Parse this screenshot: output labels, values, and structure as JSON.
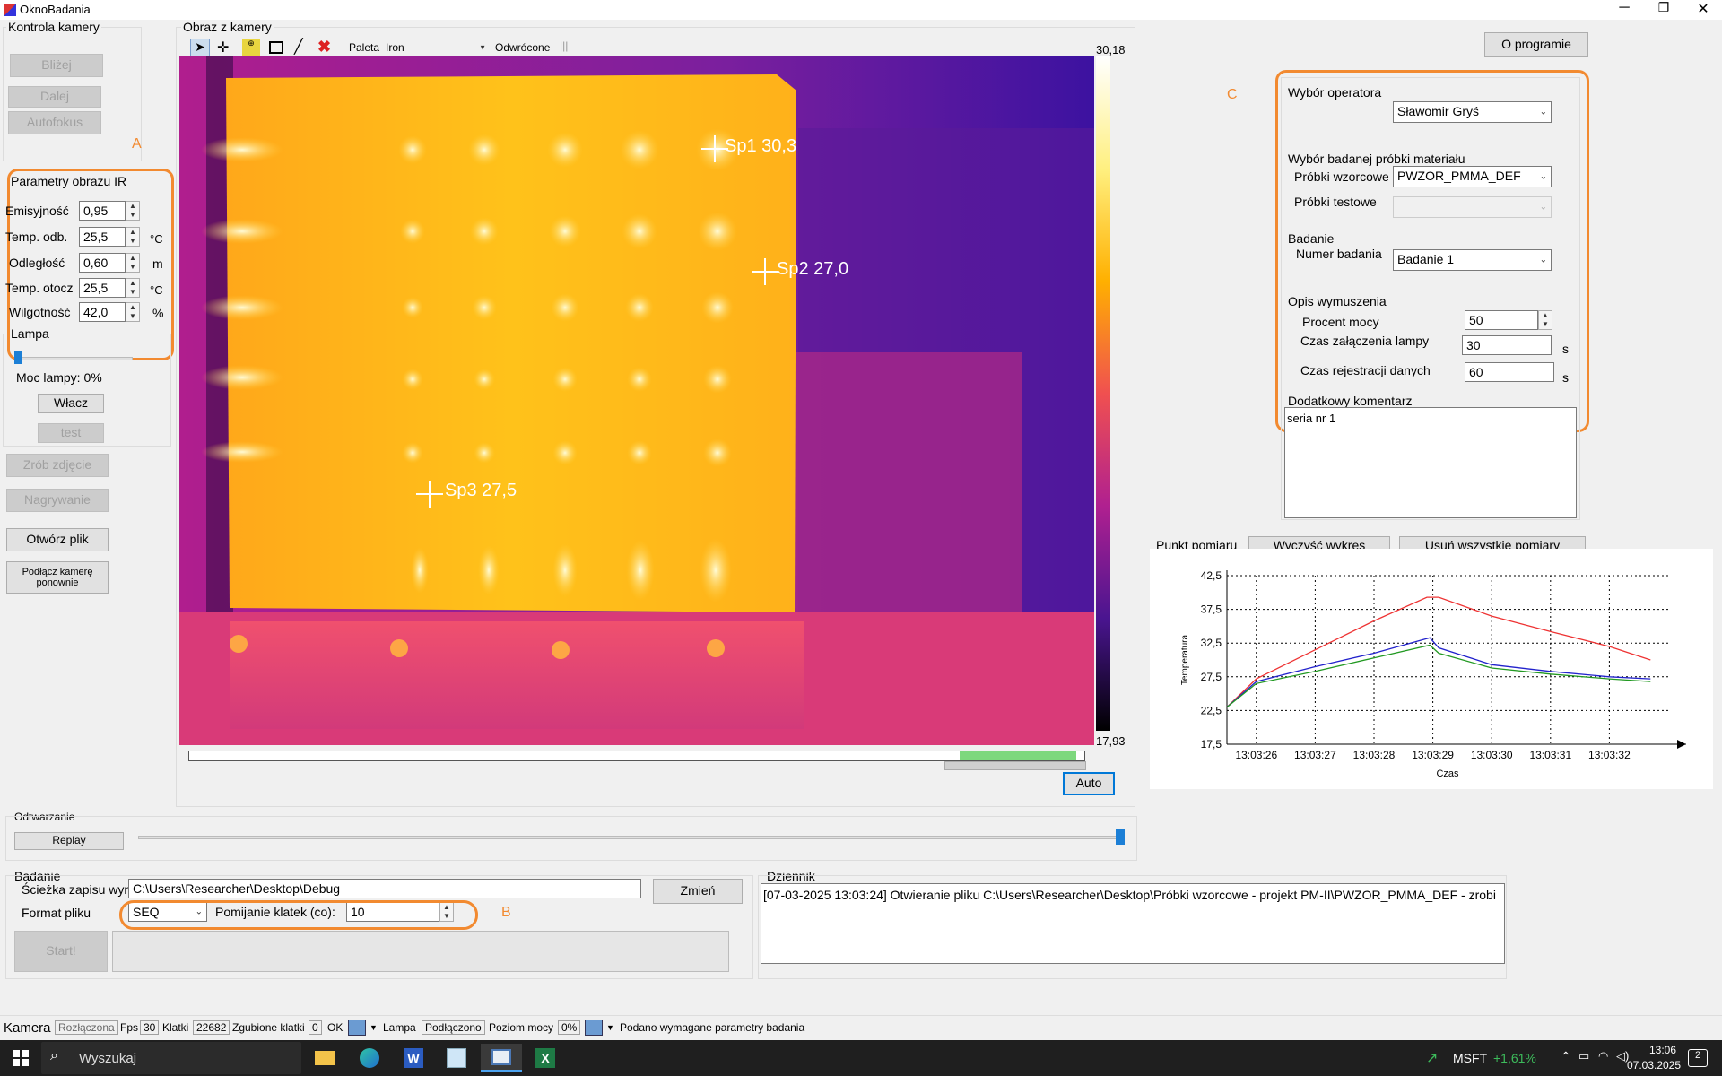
{
  "window": {
    "title": "OknoBadania"
  },
  "camera_control": {
    "title": "Kontrola kamery",
    "closer": "Bliżej",
    "further": "Dalej",
    "autofocus": "Autofokus",
    "annotation": "A"
  },
  "ir_params": {
    "title": "Parametry obrazu IR",
    "emissivity_label": "Emisyjność",
    "emissivity": "0,95",
    "temp_refl_label": "Temp. odb.",
    "temp_refl": "25,5",
    "temp_refl_unit": "°C",
    "distance_label": "Odległość",
    "distance": "0,60",
    "distance_unit": "m",
    "temp_amb_label": "Temp. otocz",
    "temp_amb": "25,5",
    "temp_amb_unit": "°C",
    "humidity_label": "Wilgotność",
    "humidity": "42,0",
    "humidity_unit": "%"
  },
  "lamp": {
    "title": "Lampa",
    "power_text": "Moc lampy: 0%",
    "turn_on": "Włacz",
    "test": "test",
    "slider_level": 0
  },
  "actions": {
    "snapshot": "Zrób zdjęcie",
    "recording": "Nagrywanie",
    "open_file": "Otwórz plik",
    "reconnect": "Podłącz kamerę ponownie"
  },
  "camera_image": {
    "title": "Obraz z kamery",
    "palette_label": "Paleta",
    "palette_value": "Iron",
    "inverted_label": "Odwrócone",
    "scale_max": "30,18",
    "scale_min": "17,93",
    "spots": [
      {
        "name": "Sp1",
        "value": "30,3"
      },
      {
        "name": "Sp2",
        "value": "27,0"
      },
      {
        "name": "Sp3",
        "value": "27,5"
      }
    ],
    "auto_button": "Auto",
    "range_low": 0.86,
    "range_high": 0.99
  },
  "playback": {
    "title": "Odtwarzanie",
    "replay": "Replay",
    "position": 1.0
  },
  "study": {
    "title": "Badanie",
    "path_label": "Ścieżka zapisu wyn",
    "path_value": "C:\\Users\\Researcher\\Desktop\\Debug",
    "change_button": "Zmień",
    "format_label": "Format pliku",
    "format_value": "SEQ",
    "skip_label": "Pomijanie klatek (co):",
    "skip_value": "10",
    "start_button": "Start!",
    "annotation": "B"
  },
  "log": {
    "title": "Dziennik",
    "entry": "[07-03-2025 13:03:24] Otwieranie pliku C:\\Users\\Researcher\\Desktop\\Próbki wzorcowe - projekt PM-II\\PWZOR_PMMA_DEF - zrobi"
  },
  "about_button": "O programie",
  "right_panel": {
    "annotation": "C",
    "operator_title": "Wybór operatora",
    "operator_value": "Sławomir Gryś",
    "sample_title": "Wybór badanej próbki materiału",
    "ref_samples_label": "Próbki wzorcowe",
    "ref_samples_value": "PWZOR_PMMA_DEF",
    "test_samples_label": "Próbki testowe",
    "test_title": "Badanie",
    "test_number_label": "Numer badania",
    "test_number_value": "Badanie 1",
    "excitation_title": "Opis wymuszenia",
    "power_percent_label": "Procent mocy",
    "power_percent_value": "50",
    "lamp_on_time_label": "Czas załączenia lampy",
    "lamp_on_time_value": "30",
    "lamp_on_time_unit": "s",
    "record_time_label": "Czas rejestracji danych",
    "record_time_value": "60",
    "record_time_unit": "s",
    "comment_title": "Dodatkowy komentarz",
    "comment_value": "seria nr 1"
  },
  "measurement": {
    "title": "Punkt pomiaru",
    "clear_chart": "Wyczyść wykres",
    "remove_all": "Usuń wszystkie pomiary"
  },
  "chart_data": {
    "type": "line",
    "xlabel": "Czas",
    "ylabel": "Temperatura",
    "ylim": [
      17.5,
      42.5
    ],
    "yticks": [
      "42,5",
      "37,5",
      "32,5",
      "27,5",
      "22,5",
      "17,5"
    ],
    "xticks": [
      "13:03:26",
      "13:03:27",
      "13:03:28",
      "13:03:29",
      "13:03:30",
      "13:03:31",
      "13:03:32"
    ],
    "xlim": [
      0,
      7.5
    ],
    "grid": true,
    "series": [
      {
        "color": "#ee3333",
        "x": [
          0,
          0.5,
          1.5,
          2.5,
          3.4,
          3.6,
          4.5,
          5.5,
          6.5,
          7.2
        ],
        "y": [
          23.0,
          27.2,
          31.5,
          35.8,
          39.3,
          39.3,
          36.5,
          34.2,
          32.0,
          30.0
        ]
      },
      {
        "color": "#2222cc",
        "x": [
          0,
          0.5,
          1.5,
          2.5,
          3.45,
          3.6,
          4.5,
          5.5,
          6.5,
          7.2
        ],
        "y": [
          23.0,
          26.8,
          29.0,
          31.0,
          33.3,
          31.8,
          29.3,
          28.3,
          27.5,
          27.2
        ]
      },
      {
        "color": "#229922",
        "x": [
          0,
          0.5,
          1.5,
          2.5,
          3.45,
          3.6,
          4.5,
          5.5,
          6.5,
          7.2
        ],
        "y": [
          23.0,
          26.5,
          28.3,
          30.3,
          32.2,
          31.0,
          28.8,
          27.9,
          27.2,
          26.8
        ]
      }
    ]
  },
  "status_bar": {
    "camera_label": "Kamera",
    "camera_state": "Rozłączona",
    "fps_label": "Fps",
    "fps": "30",
    "frames_label": "Klatki",
    "frames": "22682",
    "lost_label": "Zgubione klatki",
    "lost": "0",
    "ok": "OK",
    "lamp_label": "Lampa",
    "lamp_state": "Podłączono",
    "power_label": "Poziom mocy",
    "power": "0%",
    "message": "Podano wymagane parametry badania"
  },
  "taskbar": {
    "search": "Wyszukaj",
    "ticker": "MSFT",
    "change": "+1,61%",
    "time": "13:06",
    "date": "07.03.2025",
    "notifications": "2"
  }
}
